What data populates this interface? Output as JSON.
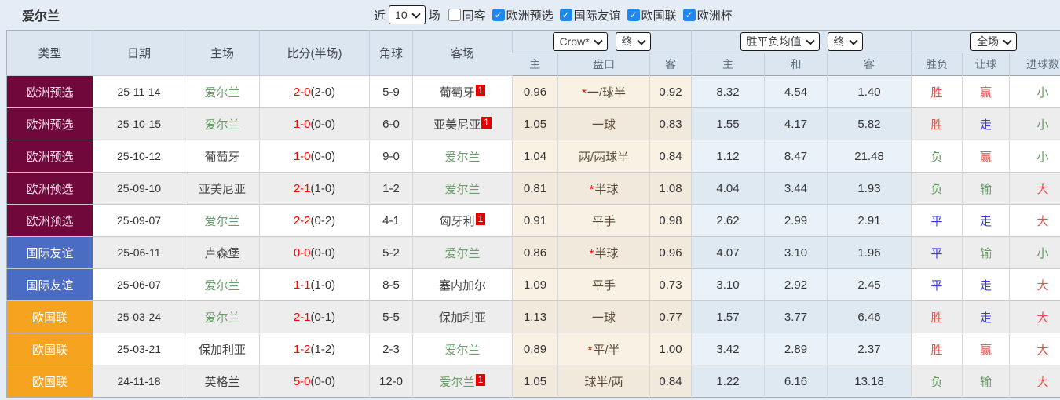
{
  "toolbar": {
    "team": "爱尔兰",
    "recent_prefix": "近",
    "recent_count": "10",
    "recent_suffix": "场",
    "filters": [
      {
        "label": "同客",
        "checked": false
      },
      {
        "label": "欧洲预选",
        "checked": true
      },
      {
        "label": "国际友谊",
        "checked": true
      },
      {
        "label": "欧国联",
        "checked": true
      },
      {
        "label": "欧洲杯",
        "checked": true
      }
    ]
  },
  "table": {
    "columns": [
      "类型",
      "日期",
      "主场",
      "比分(半场)",
      "角球",
      "客场"
    ],
    "selects": {
      "company": "Crow*",
      "company_period": "终",
      "avg": "胜平负均值",
      "avg_period": "终",
      "scope": "全场"
    },
    "odds_subcols": [
      "主",
      "盘口",
      "客"
    ],
    "avg_subcols": [
      "主",
      "和",
      "客"
    ],
    "result_subcols": [
      "胜负",
      "让球",
      "进球数"
    ],
    "star_char": "*",
    "legend_colors": {
      "qualifier_bg": "#70083c",
      "friendly_bg": "#4a6cc3",
      "nations_bg": "#f6a41f",
      "win_red": "#e4504d",
      "lose_green": "#5e965e",
      "draw_blue": "#3838e8",
      "score_red": "#ff0000",
      "team_green": "#6d9e6d",
      "badge_red": "#e60000",
      "checkbox_blue": "#1e87f0"
    },
    "rows": [
      {
        "type": "欧洲预选",
        "type_key": "qual",
        "date": "25-11-14",
        "home": "爱尔兰",
        "home_green": true,
        "home_badge": "",
        "score": "2-0",
        "half": "(2-0)",
        "corner": "5-9",
        "away": "葡萄牙",
        "away_green": false,
        "away_badge": "1",
        "star": true,
        "odds": [
          "0.96",
          "一/球半",
          "0.92"
        ],
        "avg": [
          "8.32",
          "4.54",
          "1.40"
        ],
        "result": {
          "t": "胜",
          "c": "r"
        },
        "let": {
          "t": "赢",
          "c": "r"
        },
        "goal": {
          "t": "小",
          "c": "g"
        }
      },
      {
        "type": "欧洲预选",
        "type_key": "qual",
        "date": "25-10-15",
        "home": "爱尔兰",
        "home_green": true,
        "home_badge": "",
        "score": "1-0",
        "half": "(0-0)",
        "corner": "6-0",
        "away": "亚美尼亚",
        "away_green": false,
        "away_badge": "1",
        "star": false,
        "odds": [
          "1.05",
          "一球",
          "0.83"
        ],
        "avg": [
          "1.55",
          "4.17",
          "5.82"
        ],
        "result": {
          "t": "胜",
          "c": "r"
        },
        "let": {
          "t": "走",
          "c": "b"
        },
        "goal": {
          "t": "小",
          "c": "g"
        }
      },
      {
        "type": "欧洲预选",
        "type_key": "qual",
        "date": "25-10-12",
        "home": "葡萄牙",
        "home_green": false,
        "home_badge": "",
        "score": "1-0",
        "half": "(0-0)",
        "corner": "9-0",
        "away": "爱尔兰",
        "away_green": true,
        "away_badge": "",
        "star": false,
        "odds": [
          "1.04",
          "两/两球半",
          "0.84"
        ],
        "avg": [
          "1.12",
          "8.47",
          "21.48"
        ],
        "result": {
          "t": "负",
          "c": "g"
        },
        "let": {
          "t": "赢",
          "c": "r"
        },
        "goal": {
          "t": "小",
          "c": "g"
        }
      },
      {
        "type": "欧洲预选",
        "type_key": "qual",
        "date": "25-09-10",
        "home": "亚美尼亚",
        "home_green": false,
        "home_badge": "",
        "score": "2-1",
        "half": "(1-0)",
        "corner": "1-2",
        "away": "爱尔兰",
        "away_green": true,
        "away_badge": "",
        "star": true,
        "odds": [
          "0.81",
          "半球",
          "1.08"
        ],
        "avg": [
          "4.04",
          "3.44",
          "1.93"
        ],
        "result": {
          "t": "负",
          "c": "g"
        },
        "let": {
          "t": "输",
          "c": "g"
        },
        "goal": {
          "t": "大",
          "c": "r"
        }
      },
      {
        "type": "欧洲预选",
        "type_key": "qual",
        "date": "25-09-07",
        "home": "爱尔兰",
        "home_green": true,
        "home_badge": "",
        "score": "2-2",
        "half": "(0-2)",
        "corner": "4-1",
        "away": "匈牙利",
        "away_green": false,
        "away_badge": "1",
        "star": false,
        "odds": [
          "0.91",
          "平手",
          "0.98"
        ],
        "avg": [
          "2.62",
          "2.99",
          "2.91"
        ],
        "result": {
          "t": "平",
          "c": "b"
        },
        "let": {
          "t": "走",
          "c": "b"
        },
        "goal": {
          "t": "大",
          "c": "r"
        }
      },
      {
        "type": "国际友谊",
        "type_key": "friendly",
        "date": "25-06-11",
        "home": "卢森堡",
        "home_green": false,
        "home_badge": "",
        "score": "0-0",
        "half": "(0-0)",
        "corner": "5-2",
        "away": "爱尔兰",
        "away_green": true,
        "away_badge": "",
        "star": true,
        "odds": [
          "0.86",
          "半球",
          "0.96"
        ],
        "avg": [
          "4.07",
          "3.10",
          "1.96"
        ],
        "result": {
          "t": "平",
          "c": "b"
        },
        "let": {
          "t": "输",
          "c": "g"
        },
        "goal": {
          "t": "小",
          "c": "g"
        }
      },
      {
        "type": "国际友谊",
        "type_key": "friendly",
        "date": "25-06-07",
        "home": "爱尔兰",
        "home_green": true,
        "home_badge": "",
        "score": "1-1",
        "half": "(1-0)",
        "corner": "8-5",
        "away": "塞内加尔",
        "away_green": false,
        "away_badge": "",
        "star": false,
        "odds": [
          "1.09",
          "平手",
          "0.73"
        ],
        "avg": [
          "3.10",
          "2.92",
          "2.45"
        ],
        "result": {
          "t": "平",
          "c": "b"
        },
        "let": {
          "t": "走",
          "c": "b"
        },
        "goal": {
          "t": "大",
          "c": "r"
        }
      },
      {
        "type": "欧国联",
        "type_key": "nations",
        "date": "25-03-24",
        "home": "爱尔兰",
        "home_green": true,
        "home_badge": "",
        "score": "2-1",
        "half": "(0-1)",
        "corner": "5-5",
        "away": "保加利亚",
        "away_green": false,
        "away_badge": "",
        "star": false,
        "odds": [
          "1.13",
          "一球",
          "0.77"
        ],
        "avg": [
          "1.57",
          "3.77",
          "6.46"
        ],
        "result": {
          "t": "胜",
          "c": "r"
        },
        "let": {
          "t": "走",
          "c": "b"
        },
        "goal": {
          "t": "大",
          "c": "r"
        }
      },
      {
        "type": "欧国联",
        "type_key": "nations",
        "date": "25-03-21",
        "home": "保加利亚",
        "home_green": false,
        "home_badge": "",
        "score": "1-2",
        "half": "(1-2)",
        "corner": "2-3",
        "away": "爱尔兰",
        "away_green": true,
        "away_badge": "",
        "star": true,
        "odds": [
          "0.89",
          "平/半",
          "1.00"
        ],
        "avg": [
          "3.42",
          "2.89",
          "2.37"
        ],
        "result": {
          "t": "胜",
          "c": "r"
        },
        "let": {
          "t": "赢",
          "c": "r"
        },
        "goal": {
          "t": "大",
          "c": "r"
        }
      },
      {
        "type": "欧国联",
        "type_key": "nations",
        "date": "24-11-18",
        "home": "英格兰",
        "home_green": false,
        "home_badge": "",
        "score": "5-0",
        "half": "(0-0)",
        "corner": "12-0",
        "away": "爱尔兰",
        "away_green": true,
        "away_badge": "1",
        "star": false,
        "odds": [
          "1.05",
          "球半/两",
          "0.84"
        ],
        "avg": [
          "1.22",
          "6.16",
          "13.18"
        ],
        "result": {
          "t": "负",
          "c": "g"
        },
        "let": {
          "t": "输",
          "c": "g"
        },
        "goal": {
          "t": "大",
          "c": "r"
        }
      }
    ]
  }
}
